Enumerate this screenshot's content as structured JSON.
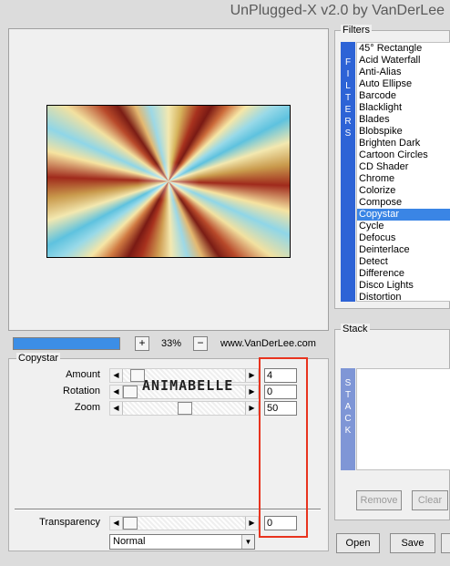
{
  "window": {
    "title": "UnPlugged-X v2.0 by VanDerLee"
  },
  "preview": {
    "progress_fraction": 1.0,
    "zoom_in": "+",
    "zoom_value": "33%",
    "zoom_out": "−",
    "website": "www.VanDerLee.com"
  },
  "filter_panel": {
    "name": "Copystar",
    "params": [
      {
        "label": "Amount",
        "value": "4"
      },
      {
        "label": "Rotation",
        "value": "0"
      },
      {
        "label": "Zoom",
        "value": "50"
      }
    ],
    "transparency": {
      "label": "Transparency",
      "value": "0"
    },
    "blend_mode": "Normal",
    "watermark": "ANIMABELLE"
  },
  "filters": {
    "label": "Filters",
    "side_letters": [
      "F",
      "I",
      "L",
      "T",
      "E",
      "R",
      "S"
    ],
    "items": [
      "45° Rectangle",
      "Acid Waterfall",
      "Anti-Alias",
      "Auto Ellipse",
      "Barcode",
      "Blacklight",
      "Blades",
      "Blobspike",
      "Brighten Dark",
      "Cartoon Circles",
      "CD Shader",
      "Chrome",
      "Colorize",
      "Compose",
      "Copystar",
      "Cycle",
      "Defocus",
      "Deinterlace",
      "Detect",
      "Difference",
      "Disco Lights",
      "Distortion"
    ],
    "selected": "Copystar"
  },
  "stack": {
    "label": "Stack",
    "side_letters": [
      "S",
      "T",
      "A",
      "C",
      "K"
    ],
    "remove_label": "Remove",
    "clear_label": "Clear"
  },
  "footer": {
    "open_label": "Open",
    "save_label": "Save"
  },
  "colors": {
    "accent": "#3a85e5",
    "highlight_box": "#e8331e",
    "filters_bar": "#2d63d6"
  }
}
